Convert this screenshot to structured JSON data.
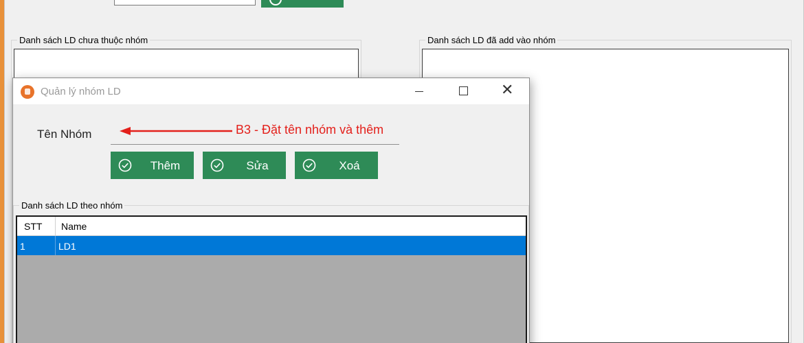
{
  "background_window": {
    "group_left_title": "Danh sách LD chưa thuộc nhóm",
    "group_right_title": "Danh sách LD đã add vào nhóm"
  },
  "dialog": {
    "title": "Quản lý nhóm LD",
    "name_label": "Tên Nhóm",
    "name_value": "",
    "annotation": "B3 - Đặt tên nhóm và thêm",
    "buttons": {
      "add": "Thêm",
      "edit": "Sửa",
      "delete": "Xoá"
    },
    "group_title": "Danh sách LD theo nhóm",
    "table": {
      "columns": [
        "STT",
        "Name"
      ],
      "rows": [
        {
          "stt": "1",
          "name": "LD1"
        }
      ]
    }
  },
  "colors": {
    "button_green": "#2e8b57",
    "selection_blue": "#0078d7",
    "annotation_red": "#e3201b",
    "grid_empty_gray": "#ababab"
  },
  "icons": [
    "app-icon",
    "minimize-icon",
    "maximize-icon",
    "close-icon",
    "check-circle-icon",
    "arrow-left-icon"
  ]
}
